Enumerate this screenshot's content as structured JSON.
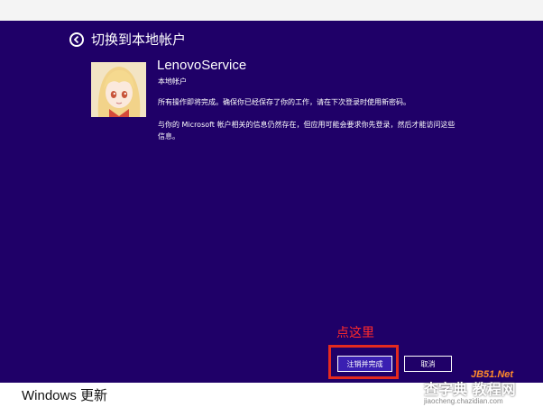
{
  "header": {
    "title": "切换到本地帐户",
    "back_icon": "back-arrow-icon"
  },
  "account": {
    "name": "LenovoService",
    "type": "本地帐户"
  },
  "messages": [
    "所有操作即将完成。确保你已经保存了你的工作，请在下次登录时使用新密码。",
    "与你的 Microsoft 帐户相关的信息仍然存在，但应用可能会要求你先登录，然后才能访问这些信息。"
  ],
  "actions": {
    "primary_label": "注销并完成",
    "cancel_label": "取消"
  },
  "annotation": {
    "text": "点这里",
    "color": "#e42a1f"
  },
  "window": {
    "bottom_title": "Windows 更新"
  },
  "watermark": {
    "logo": "JB51.Net",
    "site_cn": "查字典 教程网",
    "url": "jiaocheng.chazidian.com"
  },
  "colors": {
    "panel_bg": "#1f0068",
    "primary_button": "#3a1fb2",
    "text": "#ffffff"
  }
}
